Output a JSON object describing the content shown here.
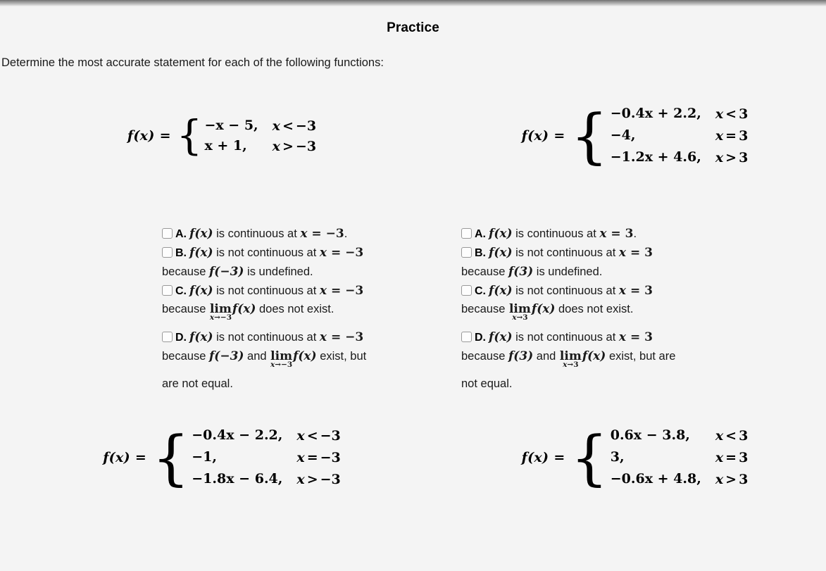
{
  "page": {
    "title": "Practice",
    "prompt": "Determine the most accurate statement for each of the following functions:",
    "background_color": "#f4f4f4",
    "topbar_color": "#8d8d8d"
  },
  "functions": {
    "top_left": {
      "lhs": "f(x)",
      "equals": "=",
      "brace": "{",
      "cases": [
        {
          "expr": "−x − 5,",
          "cond_var": "x",
          "cond_rel": "<",
          "cond_val": "−3"
        },
        {
          "expr": "x + 1,",
          "cond_var": "x",
          "cond_rel": ">",
          "cond_val": "−3"
        }
      ]
    },
    "top_right": {
      "lhs": "f(x)",
      "equals": "=",
      "brace": "{",
      "cases": [
        {
          "expr": "−0.4x + 2.2,",
          "cond_var": "x",
          "cond_rel": "<",
          "cond_val": "3"
        },
        {
          "expr": "−4,",
          "cond_var": "x",
          "cond_rel": "=",
          "cond_val": "3"
        },
        {
          "expr": "−1.2x + 4.6,",
          "cond_var": "x",
          "cond_rel": ">",
          "cond_val": "3"
        }
      ]
    },
    "bottom_left": {
      "lhs": "f(x)",
      "equals": "=",
      "brace": "{",
      "cases": [
        {
          "expr": "−0.4x − 2.2,",
          "cond_var": "x",
          "cond_rel": "<",
          "cond_val": "−3"
        },
        {
          "expr": "−1,",
          "cond_var": "x",
          "cond_rel": "=",
          "cond_val": "−3"
        },
        {
          "expr": "−1.8x − 6.4,",
          "cond_var": "x",
          "cond_rel": ">",
          "cond_val": "−3"
        }
      ]
    },
    "bottom_right": {
      "lhs": "f(x)",
      "equals": "=",
      "brace": "{",
      "cases": [
        {
          "expr": "0.6x − 3.8,",
          "cond_var": "x",
          "cond_rel": "<",
          "cond_val": "3"
        },
        {
          "expr": "3,",
          "cond_var": "x",
          "cond_rel": "=",
          "cond_val": "3"
        },
        {
          "expr": "−0.6x + 4.8,",
          "cond_var": "x",
          "cond_rel": ">",
          "cond_val": "3"
        }
      ]
    }
  },
  "options_left": {
    "point": "−3",
    "A": {
      "label": "A.",
      "fx": "f(x)",
      "text1": " is continuous at ",
      "var": "x",
      "eq": " = ",
      "val": "−3",
      "text2": "."
    },
    "B": {
      "label": "B.",
      "fx": "f(x)",
      "text1": " is not continuous at ",
      "var": "x",
      "eq": " = ",
      "val": "−3",
      "text2": "because ",
      "fval": "f(−3)",
      "text3": " is undefined."
    },
    "C": {
      "label": "C.",
      "fx": "f(x)",
      "text1": " is not continuous at ",
      "var": "x",
      "eq": " = ",
      "val": "−3",
      "text2": "because ",
      "lim": "lim",
      "lim_sub_var": "x",
      "lim_sub_arrow": "→",
      "lim_sub_val": "−3",
      "lim_fx": "f(x)",
      "text3": " does not exist."
    },
    "D": {
      "label": "D.",
      "fx": "f(x)",
      "text1": " is not continuous at ",
      "var": "x",
      "eq": " = ",
      "val": "−3",
      "text2": "because ",
      "fval": "f(−3)",
      "text3": " and ",
      "lim": "lim",
      "lim_sub_var": "x",
      "lim_sub_arrow": "→",
      "lim_sub_val": "−3",
      "lim_fx": "f(x)",
      "text4": " exist, but",
      "text5": "are not equal."
    }
  },
  "options_right": {
    "point": "3",
    "A": {
      "label": "A.",
      "fx": "f(x)",
      "text1": " is continuous at ",
      "var": "x",
      "eq": " = ",
      "val": "3",
      "text2": "."
    },
    "B": {
      "label": "B.",
      "fx": "f(x)",
      "text1": " is not continuous at ",
      "var": "x",
      "eq": " = ",
      "val": "3",
      "text2": "because ",
      "fval": "f(3)",
      "text3": " is undefined."
    },
    "C": {
      "label": "C.",
      "fx": "f(x)",
      "text1": " is not continuous at ",
      "var": "x",
      "eq": " = ",
      "val": "3",
      "text2": "because ",
      "lim": "lim",
      "lim_sub_var": "x",
      "lim_sub_arrow": "→",
      "lim_sub_val": "3",
      "lim_fx": "f(x)",
      "text3": " does not exist."
    },
    "D": {
      "label": "D.",
      "fx": "f(x)",
      "text1": " is not continuous at ",
      "var": "x",
      "eq": " = ",
      "val": "3",
      "text2": "because ",
      "fval": "f(3)",
      "text3": " and ",
      "lim": "lim",
      "lim_sub_var": "x",
      "lim_sub_arrow": "→",
      "lim_sub_val": "3",
      "lim_fx": "f(x)",
      "text4": " exist, but are",
      "text5": "not equal."
    }
  }
}
